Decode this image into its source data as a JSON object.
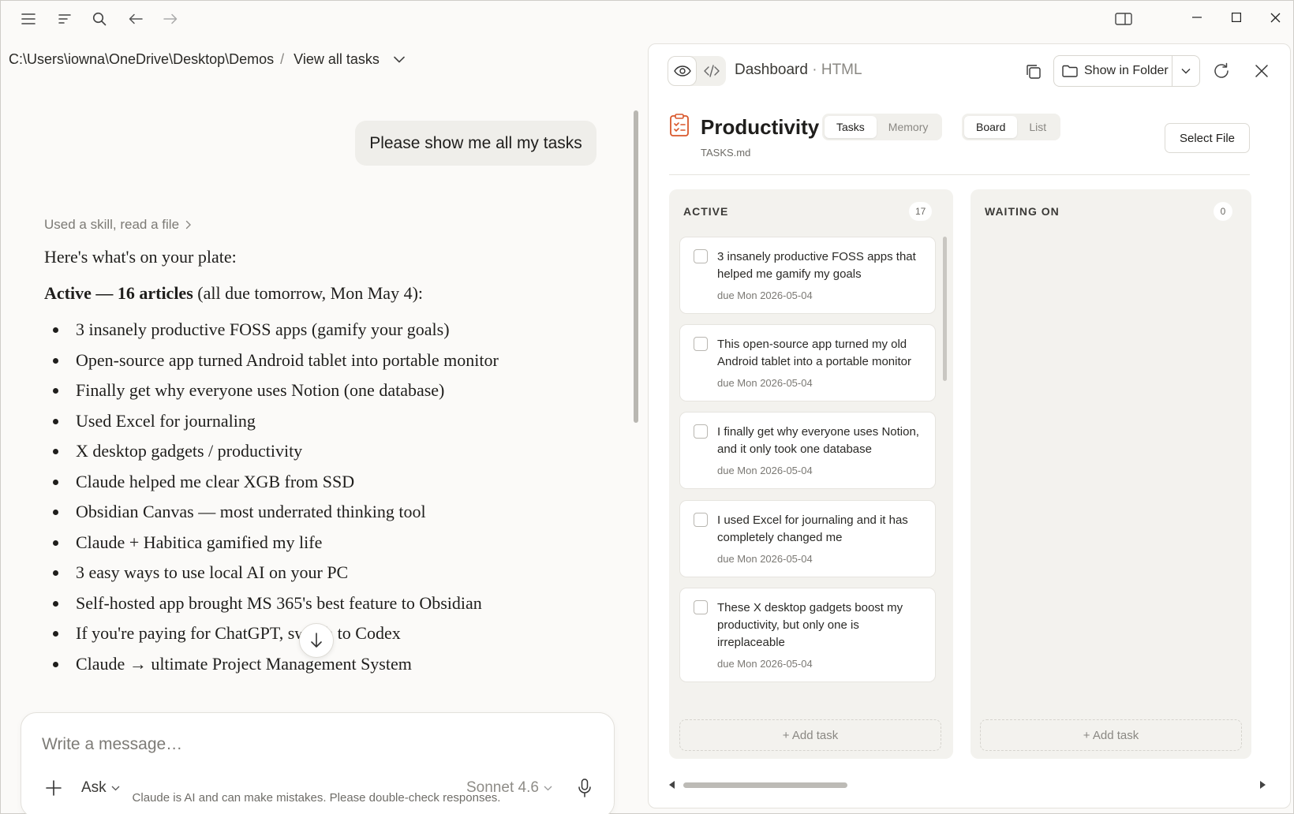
{
  "breadcrumb": {
    "path": "C:\\Users\\iowna\\OneDrive\\Desktop\\Demos",
    "separator": "/",
    "tasks_link": "View all tasks"
  },
  "chat": {
    "user_message": "Please show me all my tasks",
    "skill_note": "Used a skill, read a file",
    "intro": "Here's what's on your plate:",
    "active_heading": "Active — 16 articles",
    "active_detail": " (all due tomorrow, Mon May 4):",
    "items": [
      "3 insanely productive FOSS apps (gamify your goals)",
      "Open-source app turned Android tablet into portable monitor",
      "Finally get why everyone uses Notion (one database)",
      "Used Excel for journaling",
      "X desktop gadgets / productivity",
      "Claude helped me clear XGB from SSD",
      "Obsidian Canvas — most underrated thinking tool",
      "Claude + Habitica gamified my life",
      "3 easy ways to use local AI on your PC",
      "Self-hosted app brought MS 365's best feature to Obsidian",
      "If you're paying for ChatGPT, switch to Codex",
      "Claude → ultimate Project Management System"
    ]
  },
  "composer": {
    "placeholder": "Write a message…",
    "mode": "Ask",
    "model": "Sonnet 4.6"
  },
  "disclaimer": "Claude is AI and can make mistakes. Please double-check responses.",
  "panel": {
    "title": "Dashboard",
    "title_sep": " · ",
    "type": "HTML",
    "show_in_folder": "Show in Folder"
  },
  "dashboard": {
    "title": "Productivity",
    "file": "TASKS.md",
    "tabs": [
      "Tasks",
      "Memory"
    ],
    "views": [
      "Board",
      "List"
    ],
    "select_file": "Select File",
    "columns": [
      {
        "name": "ACTIVE",
        "count": "17",
        "add_label": "+ Add task",
        "cards": [
          {
            "title": "3 insanely productive FOSS apps that helped me gamify my goals",
            "due": "due Mon 2026-05-04"
          },
          {
            "title": "This open-source app turned my old Android tablet into a portable monitor",
            "due": "due Mon 2026-05-04"
          },
          {
            "title": "I finally get why everyone uses Notion, and it only took one database",
            "due": "due Mon 2026-05-04"
          },
          {
            "title": "I used Excel for journaling and it has completely changed me",
            "due": "due Mon 2026-05-04"
          },
          {
            "title": "These X desktop gadgets boost my productivity, but only one is irreplaceable",
            "due": "due Mon 2026-05-04"
          }
        ]
      },
      {
        "name": "WAITING ON",
        "count": "0",
        "add_label": "+ Add task",
        "cards": []
      }
    ]
  },
  "colors": {
    "accent_icon": "#d9572b",
    "bg": "#fbfaf8",
    "column_bg": "#f3f2ee"
  }
}
